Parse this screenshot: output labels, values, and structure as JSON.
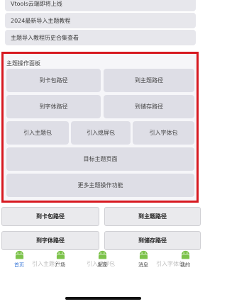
{
  "top_list": [
    "Vtools云端即将上线",
    "2024最新导入主题教程",
    "主题导入教程历史合集查看"
  ],
  "panel": {
    "title": "主题操作面板",
    "row1": [
      "到卡包路径",
      "到主题路径"
    ],
    "row2": [
      "到字体路径",
      "到储存路径"
    ],
    "row3": [
      "引入主题包",
      "引入熄屏包",
      "引入字体包"
    ],
    "row4": "目标主题页面",
    "row5": "更多主题操作功能"
  },
  "lower": {
    "row1": [
      "到卡包路径",
      "到主题路径"
    ],
    "row2": [
      "到字体路径",
      "到储存路径"
    ],
    "ghost_left": "引入主题包",
    "ghost_mid": "引入熄屏包",
    "ghost_right": "引入字体包"
  },
  "tabs": [
    {
      "label": "首页",
      "active": true
    },
    {
      "label": "广场"
    },
    {
      "label": "发现"
    },
    {
      "label": "消息"
    },
    {
      "label": "我的"
    }
  ],
  "colors": {
    "highlight": "#d71920",
    "active_tab": "#3a78d8",
    "android_green": "#7cc24a"
  }
}
